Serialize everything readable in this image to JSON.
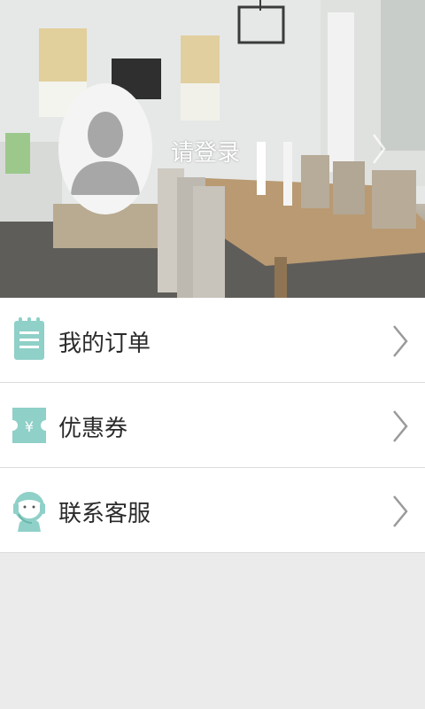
{
  "header": {
    "login_text": "请登录"
  },
  "menu": {
    "items": [
      {
        "label": "我的订单",
        "icon": "notepad-icon"
      },
      {
        "label": "优惠券",
        "icon": "coupon-yen-icon"
      },
      {
        "label": "联系客服",
        "icon": "customer-service-headset-icon"
      }
    ]
  },
  "colors": {
    "accent": "#8fd0c8",
    "background": "#ebebeb",
    "divider": "#dcdcdc",
    "text": "#2b2b2b",
    "chevron": "#9a9a9a"
  }
}
